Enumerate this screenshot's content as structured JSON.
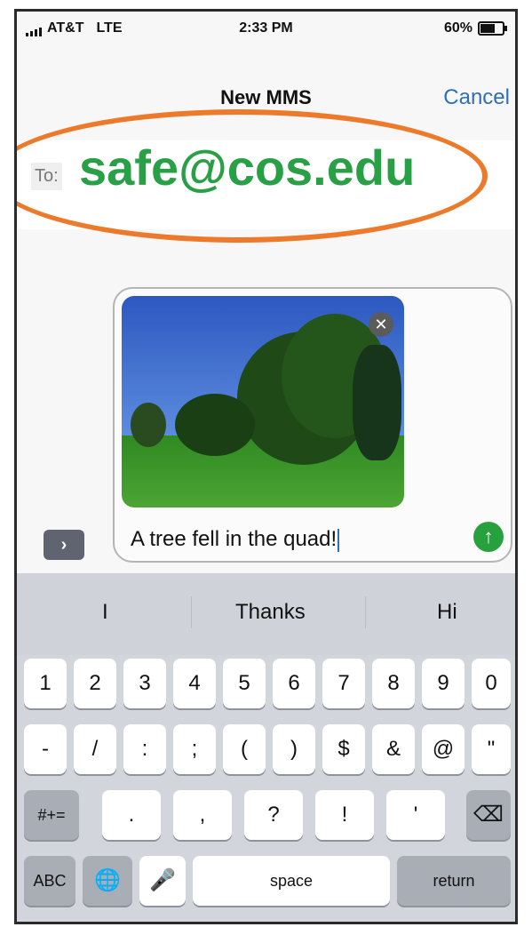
{
  "status": {
    "carrier": "AT&T",
    "network": "LTE",
    "time": "2:33 PM",
    "battery": "60%"
  },
  "nav": {
    "title": "New MMS",
    "cancel": "Cancel"
  },
  "recipient": {
    "label": "To:",
    "value": "safe@cos.edu"
  },
  "message": {
    "text": "A tree fell in the quad!",
    "remove_icon": "x-icon",
    "send_icon": "up-arrow-icon",
    "expand_icon": "chevron-right-icon"
  },
  "suggestions": [
    "I",
    "Thanks",
    "Hi"
  ],
  "keyboard": {
    "row1": [
      "1",
      "2",
      "3",
      "4",
      "5",
      "6",
      "7",
      "8",
      "9",
      "0"
    ],
    "row2": [
      "-",
      "/",
      ":",
      ";",
      "(",
      ")",
      "$",
      "&",
      "@",
      "\""
    ],
    "row3": [
      "#+=",
      ".",
      ",",
      "?",
      "!",
      "'",
      "⌫"
    ],
    "row4": [
      "ABC",
      "🌐",
      "🎤",
      "space",
      "return"
    ]
  },
  "colors": {
    "accent": "#2f6fb8",
    "recipient_green": "#2aa046",
    "highlight": "#ec7a2a",
    "send_green": "#27a13e"
  }
}
